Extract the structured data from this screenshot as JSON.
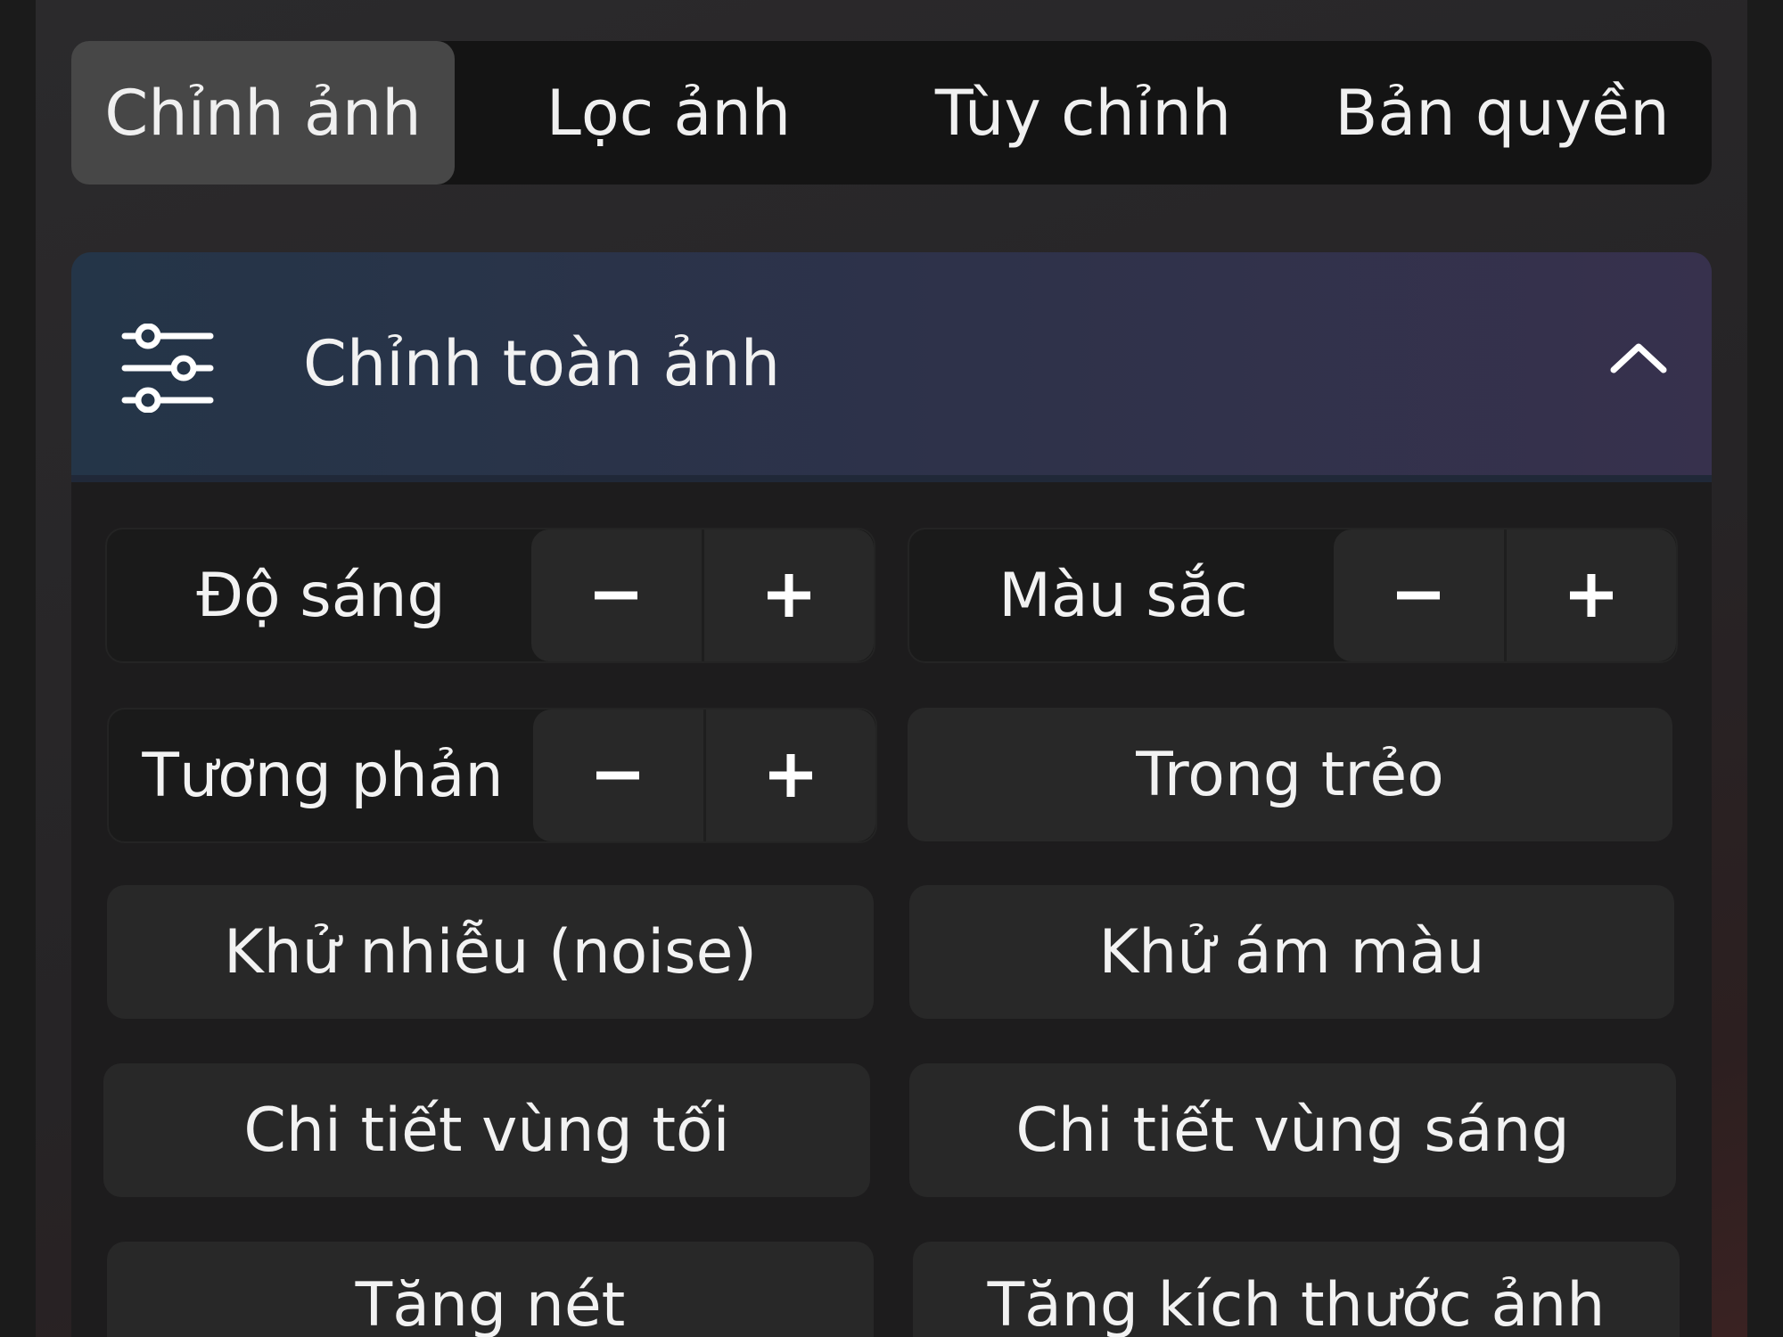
{
  "tabs": [
    {
      "label": "Chỉnh ảnh",
      "active": true
    },
    {
      "label": "Lọc ảnh",
      "active": false
    },
    {
      "label": "Tùy chỉnh",
      "active": false
    },
    {
      "label": "Bản quyền",
      "active": false
    }
  ],
  "section": {
    "title": "Chỉnh toàn ảnh",
    "icon": "sliders-icon",
    "toggle_icon": "chevron-up-icon",
    "expanded": true
  },
  "steppers": [
    {
      "label": "Độ sáng",
      "minus": "−",
      "plus": "+"
    },
    {
      "label": "Màu sắc",
      "minus": "−",
      "plus": "+"
    },
    {
      "label": "Tương phản",
      "minus": "−",
      "plus": "+"
    }
  ],
  "options": [
    "Trong trẻo",
    "Khử nhiễu (noise)",
    "Khử ám màu",
    "Chi tiết vùng tối",
    "Chi tiết vùng sáng",
    "Tăng nét",
    "Tăng kích thước ảnh"
  ],
  "colors": {
    "background": "#1b1b1b",
    "tab_bar": "#141414",
    "active_tab": "#474747",
    "header_start": "#243548",
    "header_end": "#37314d",
    "button": "#282828"
  }
}
